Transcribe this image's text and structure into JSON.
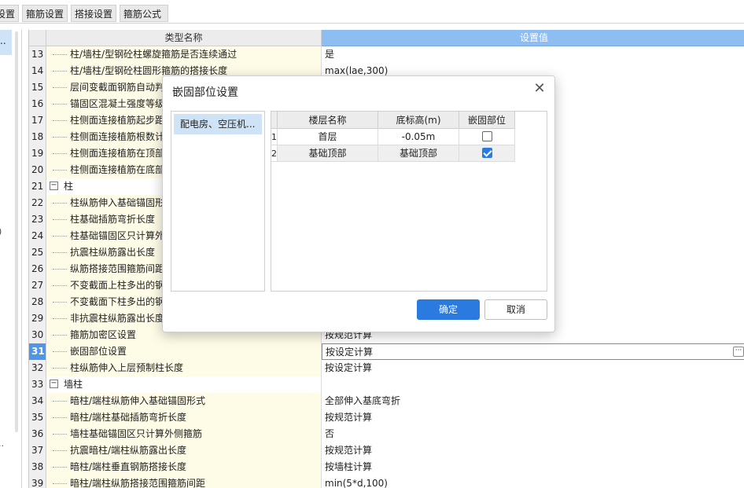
{
  "tabs": [
    "设置",
    "箍筋设置",
    "搭接设置",
    "箍筋公式"
  ],
  "left_panel": {
    "selected_text": "..",
    "glyphs": [
      ")",
      ".."
    ]
  },
  "grid": {
    "header_name": "类型名称",
    "header_value": "设置值",
    "selected_index": "31",
    "rows": [
      {
        "idx": "13",
        "name": "柱/墙柱/型钢砼柱螺旋箍筋是否连续通过",
        "value": "是"
      },
      {
        "idx": "14",
        "name": "柱/墙柱/型钢砼柱圆形箍筋的搭接长度",
        "value": "max(lae,300)"
      },
      {
        "idx": "15",
        "name": "层间变截面钢筋自动判",
        "value": ""
      },
      {
        "idx": "16",
        "name": "锚固区混凝土强度等级",
        "value": ""
      },
      {
        "idx": "17",
        "name": "柱侧面连接植筋起步距",
        "value": ""
      },
      {
        "idx": "18",
        "name": "柱侧面连接植筋根数计",
        "value": ""
      },
      {
        "idx": "19",
        "name": "柱侧面连接植筋在顶部",
        "value": ""
      },
      {
        "idx": "20",
        "name": "柱侧面连接植筋在底部",
        "value": ""
      },
      {
        "idx": "21",
        "name": "柱",
        "value": "",
        "group": true
      },
      {
        "idx": "22",
        "name": "柱纵筋伸入基础锚固形",
        "value": ""
      },
      {
        "idx": "23",
        "name": "柱基础插筋弯折长度",
        "value": ""
      },
      {
        "idx": "24",
        "name": "柱基础锚固区只计算外",
        "value": ""
      },
      {
        "idx": "25",
        "name": "抗震柱纵筋露出长度",
        "value": ""
      },
      {
        "idx": "26",
        "name": "纵筋搭接范围箍筋间距",
        "value": ""
      },
      {
        "idx": "27",
        "name": "不变截面上柱多出的钢",
        "value": ""
      },
      {
        "idx": "28",
        "name": "不变截面下柱多出的钢",
        "value": ""
      },
      {
        "idx": "29",
        "name": "非抗震柱纵筋露出长度",
        "value": ""
      },
      {
        "idx": "30",
        "name": "箍筋加密区设置",
        "value": "按规范计算"
      },
      {
        "idx": "31",
        "name": "嵌固部位设置",
        "value": "按设定计算"
      },
      {
        "idx": "32",
        "name": "柱纵筋伸入上层预制柱长度",
        "value": "按设定计算"
      },
      {
        "idx": "33",
        "name": "墙柱",
        "value": "",
        "group": true
      },
      {
        "idx": "34",
        "name": "暗柱/端柱纵筋伸入基础锚固形式",
        "value": "全部伸入基底弯折"
      },
      {
        "idx": "35",
        "name": "暗柱/端柱基础插筋弯折长度",
        "value": "按规范计算"
      },
      {
        "idx": "36",
        "name": "墙柱基础锚固区只计算外侧箍筋",
        "value": "否"
      },
      {
        "idx": "37",
        "name": "抗震暗柱/端柱纵筋露出长度",
        "value": "按规范计算"
      },
      {
        "idx": "38",
        "name": "暗柱/端柱垂直钢筋搭接长度",
        "value": "按墙柱计算"
      },
      {
        "idx": "39",
        "name": "暗柱/端柱纵筋搭接范围箍筋间距",
        "value": "min(5*d,100)"
      }
    ]
  },
  "dialog": {
    "title": "嵌固部位设置",
    "close_symbol": "✕",
    "list_items": [
      "配电房、空压机..."
    ],
    "table": {
      "headers": [
        "楼层名称",
        "底标高(m)",
        "嵌固部位"
      ],
      "rows": [
        {
          "idx": "1",
          "floor": "首层",
          "elevation": "-0.05m",
          "embedded": false
        },
        {
          "idx": "2",
          "floor": "基础顶部",
          "elevation": "基础顶部",
          "embedded": true
        }
      ]
    },
    "ok_label": "确定",
    "cancel_label": "取消"
  }
}
